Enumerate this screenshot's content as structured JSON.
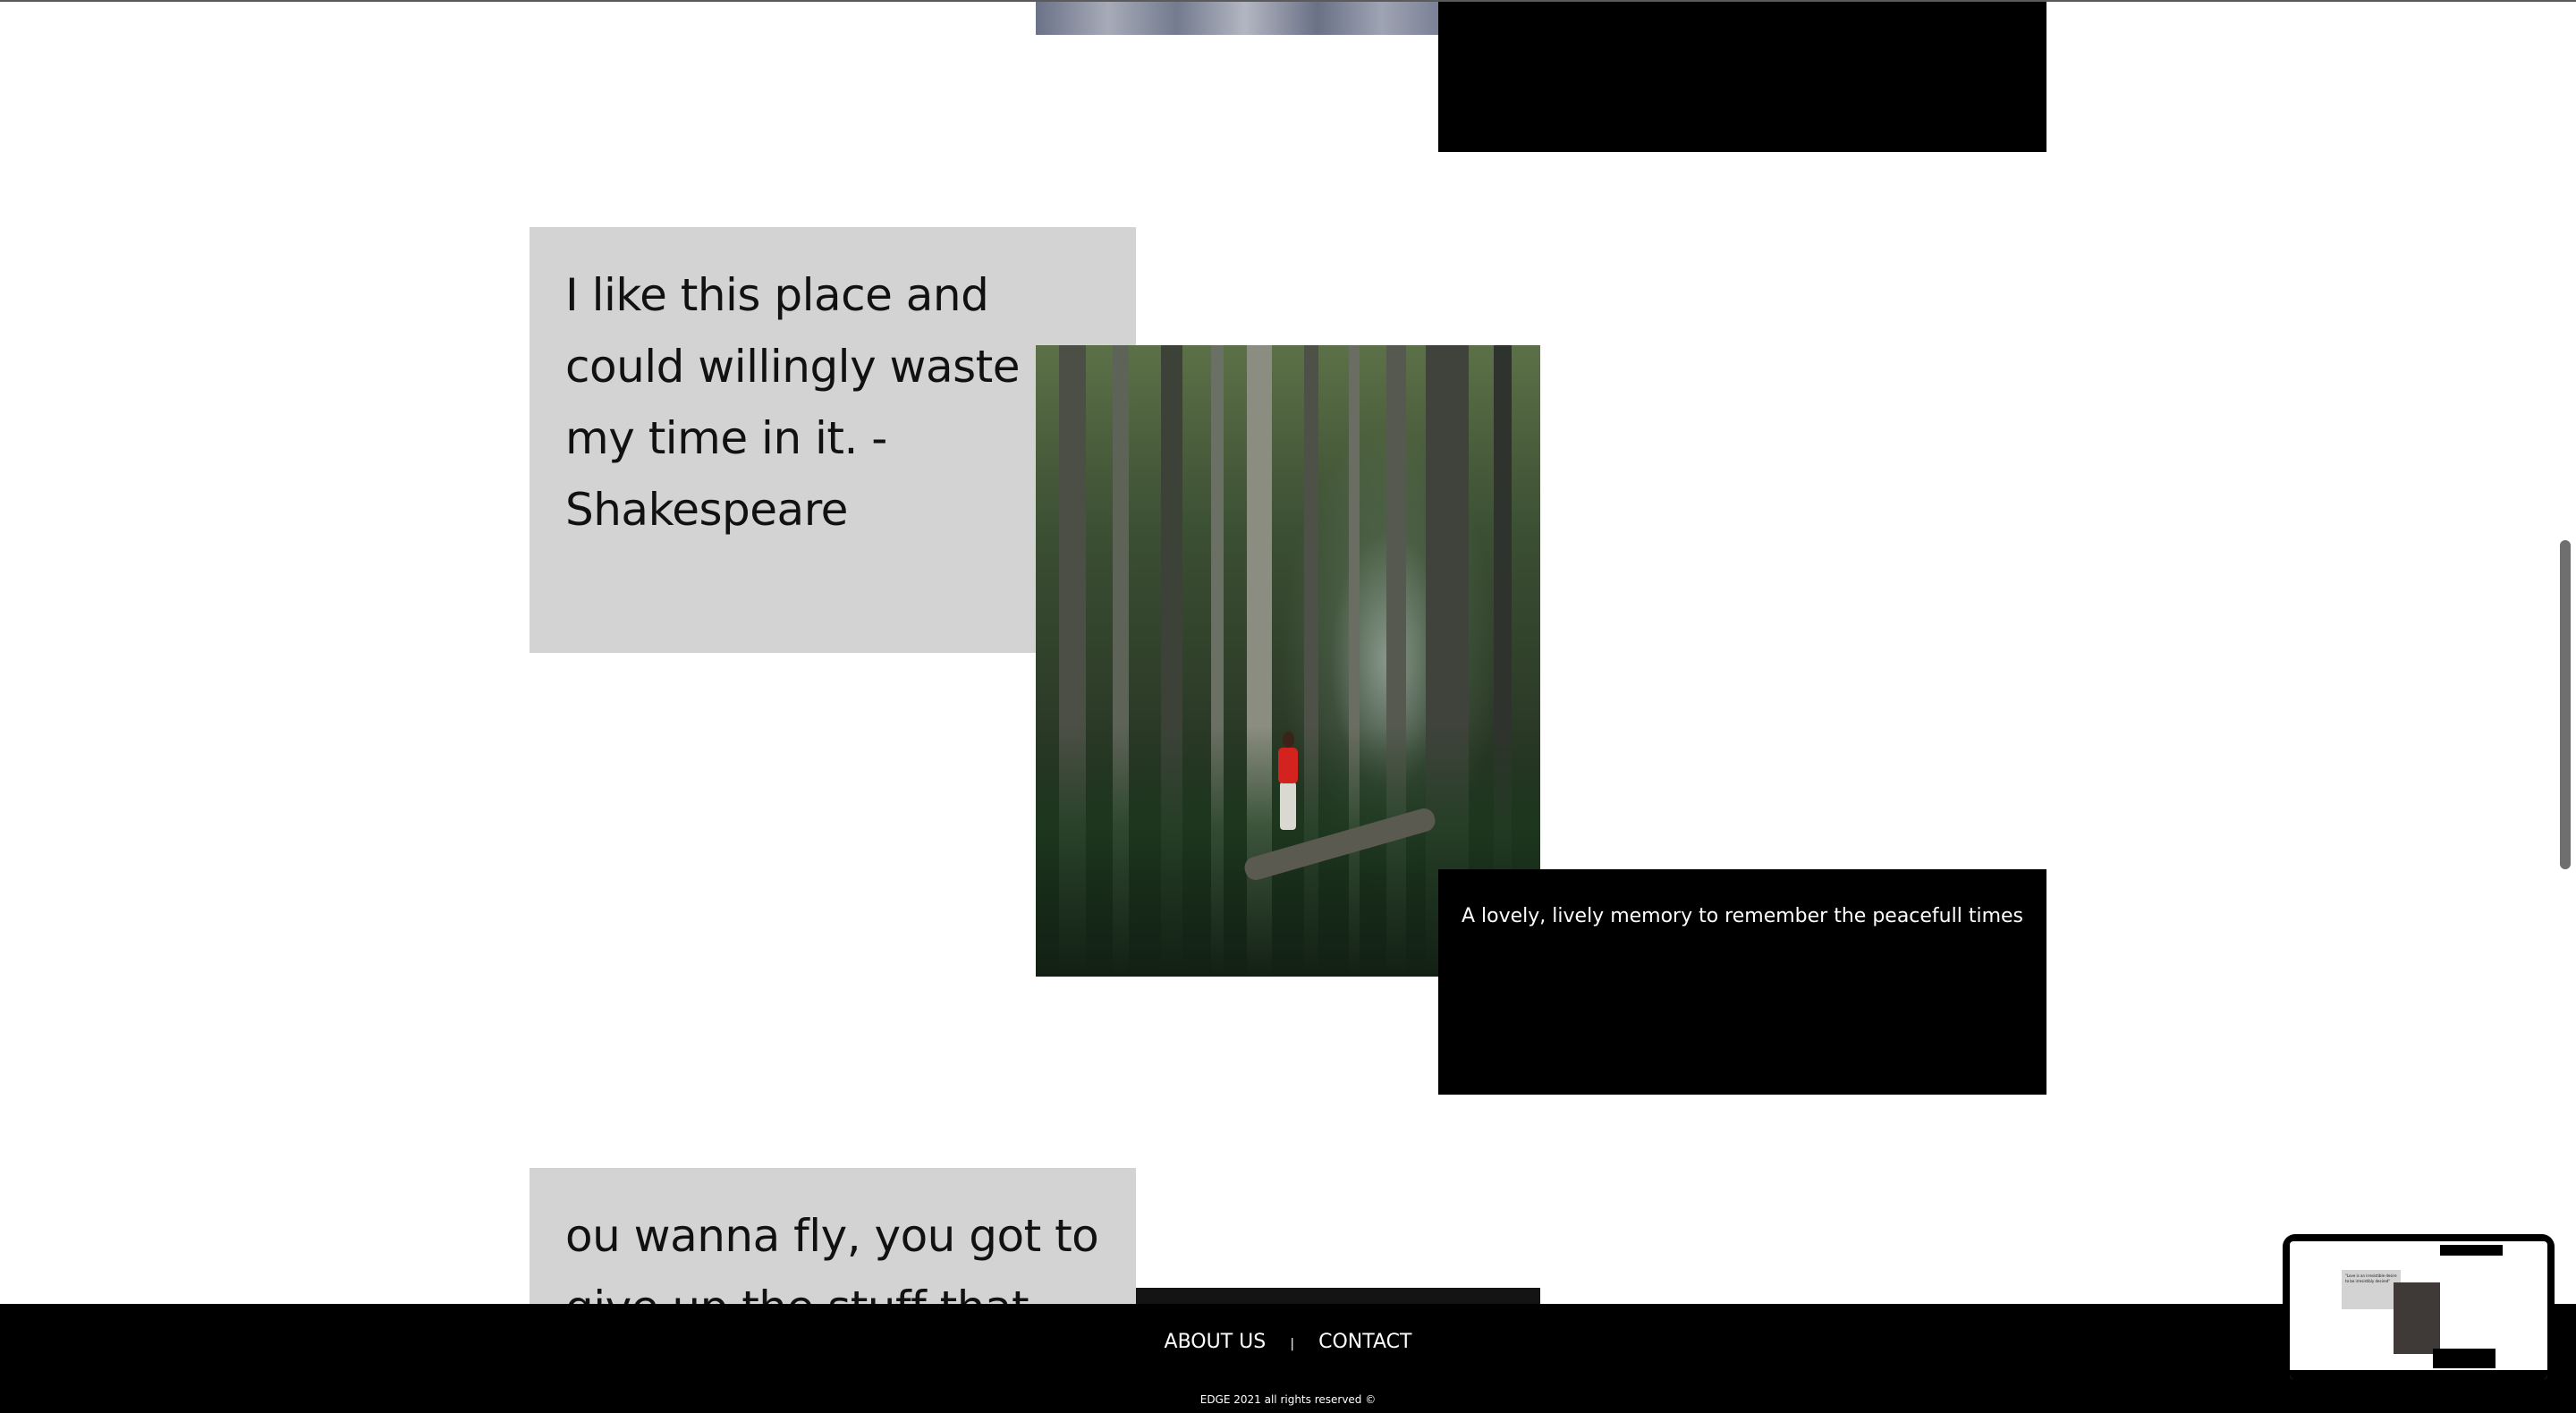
{
  "quotes": [
    {
      "text": "I like this place and could willingly waste my time in it. - Shakespeare"
    },
    {
      "text": "ou wanna fly, you got to give up the stuff that"
    }
  ],
  "captions": [
    {
      "text": "A lovely, lively memory to remember the peacefull times"
    }
  ],
  "footer": {
    "links": [
      {
        "label": "ABOUT US"
      },
      {
        "label": "CONTACT"
      }
    ],
    "separator": "|",
    "copyright": "EDGE 2021 all rights reserved ©"
  },
  "pip": {
    "quote_text": "\"Love is an irresistible desire to be irresistibly desired\""
  },
  "colors": {
    "quote_card_bg": "#d3d3d3",
    "caption_bg": "#000000",
    "footer_bg": "#000000",
    "page_bg": "#ffffff"
  }
}
